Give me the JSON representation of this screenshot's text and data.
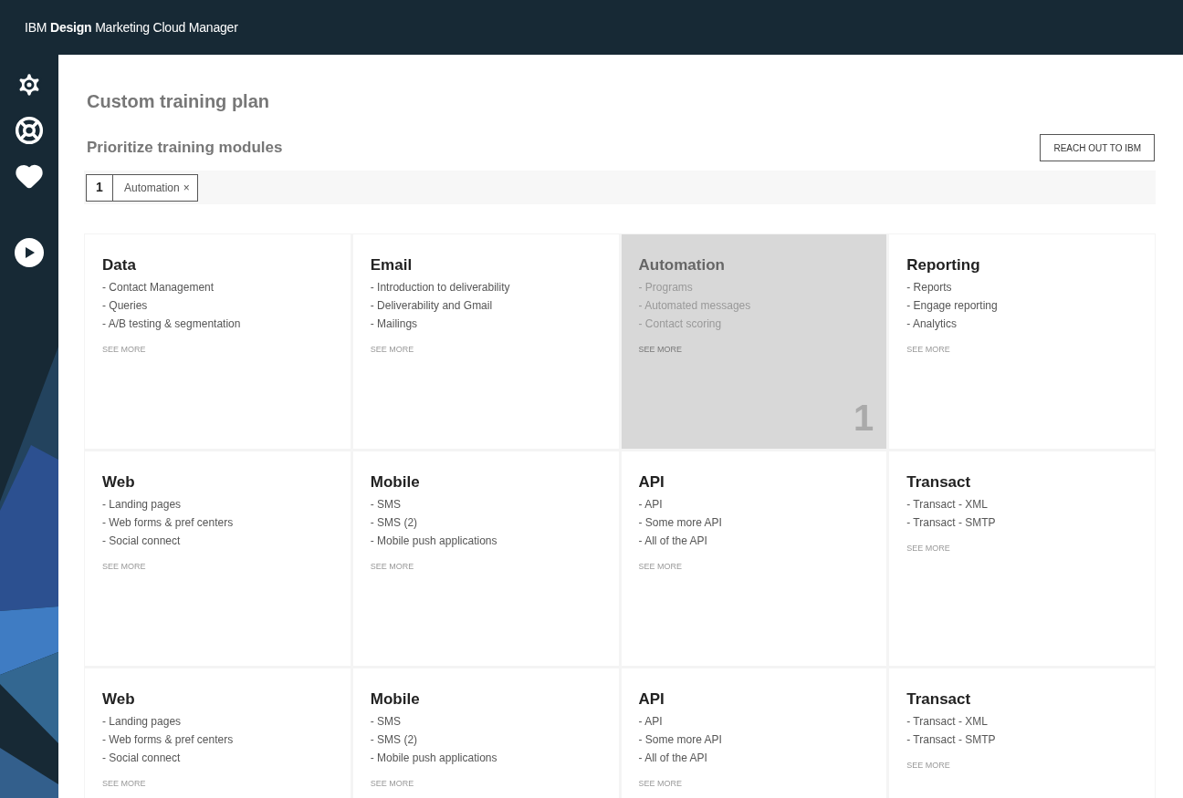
{
  "header": {
    "brand_bold": "IBM **Design** Marketing Cloud Manager"
  },
  "page_title": "Custom training plan",
  "section_title": "Prioritize training modules",
  "contact_button": "REACH OUT TO IBM",
  "priorities": [
    {
      "rank": "1",
      "label": "Automation",
      "remove": "×"
    }
  ],
  "modules": [
    {
      "title": "Data",
      "items": [
        "- Contact Management",
        "- Queries",
        "- A/B testing & segmentation"
      ],
      "see_more": "SEE MORE",
      "selected": false
    },
    {
      "title": "Email",
      "items": [
        "- Introduction to deliverability",
        "- Deliverability and Gmail",
        "- Mailings"
      ],
      "see_more": "SEE MORE",
      "selected": false
    },
    {
      "title": "Automation",
      "items": [
        "- Programs",
        "- Automated messages",
        "- Contact scoring"
      ],
      "see_more": "SEE MORE",
      "selected": true,
      "rank": "1"
    },
    {
      "title": "Reporting",
      "items": [
        "- Reports",
        "- Engage reporting",
        "- Analytics"
      ],
      "see_more": "SEE MORE",
      "selected": false
    },
    {
      "title": "Web",
      "items": [
        "- Landing pages",
        "- Web forms & pref centers",
        "- Social connect"
      ],
      "see_more": "SEE MORE",
      "selected": false
    },
    {
      "title": "Mobile",
      "items": [
        "- SMS",
        "- SMS (2)",
        "- Mobile push applications"
      ],
      "see_more": "SEE MORE",
      "selected": false
    },
    {
      "title": "API",
      "items": [
        "- API",
        "- Some more API",
        "- All of the API"
      ],
      "see_more": "SEE MORE",
      "selected": false
    },
    {
      "title": "Transact",
      "items": [
        "- Transact - XML",
        "- Transact - SMTP"
      ],
      "see_more": "SEE MORE",
      "selected": false
    },
    {
      "title": "Web",
      "items": [
        "- Landing pages",
        "- Web forms & pref centers",
        "- Social connect"
      ],
      "see_more": "SEE MORE",
      "selected": false
    },
    {
      "title": "Mobile",
      "items": [
        "- SMS",
        "- SMS (2)",
        "- Mobile push applications"
      ],
      "see_more": "SEE MORE",
      "selected": false
    },
    {
      "title": "API",
      "items": [
        "- API",
        "- Some more API",
        "- All of the API"
      ],
      "see_more": "SEE MORE",
      "selected": false
    },
    {
      "title": "Transact",
      "items": [
        "- Transact - XML",
        "- Transact - SMTP"
      ],
      "see_more": "SEE MORE",
      "selected": false
    }
  ]
}
